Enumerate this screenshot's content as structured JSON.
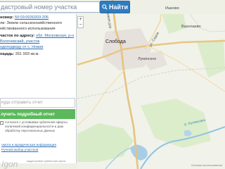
{
  "search": {
    "placeholder": "дастровый номер участка",
    "button_label": "Найти"
  },
  "panel": {
    "number_label": "номер:",
    "number_value": "50:03:0030203:205",
    "category_label": "ли:",
    "category_value": "Земли сельскохозяйственного",
    "purpose_text": "ействованного использования",
    "address_label": "часток по адресу:",
    "address_line1": "обл. Московская, р-н",
    "address_line2": "Волочевский, участок",
    "address_line3": "одоподводу от с. Новая",
    "area_label": "ощадь:",
    "area_value": "261 993 кв.м.",
    "email_placeholder": "куда отправить отчет",
    "report_button": "лучить подробный отчет",
    "consent_text": "согласен с условиями публичной оферты политикой конфиденциальности и даю обработку персональных данных",
    "info_link": "омота и юридическая информация",
    "manual_link": "Ручной выбор участков"
  },
  "map": {
    "labels": {
      "city": "Слобода",
      "nearby_village": "Лукинское",
      "village_east": "Вахолаево",
      "village_north": "Ишково",
      "river_label": "р. Кулимовка",
      "road_label_1": "Новая дор.",
      "road_label_2": "ул. Садов"
    },
    "zoom_in": "+",
    "zoom_out": "−"
  },
  "footer": {
    "logo": "Igon",
    "credit": "кадастровая публичная карта",
    "right_text": "Условия использования"
  }
}
